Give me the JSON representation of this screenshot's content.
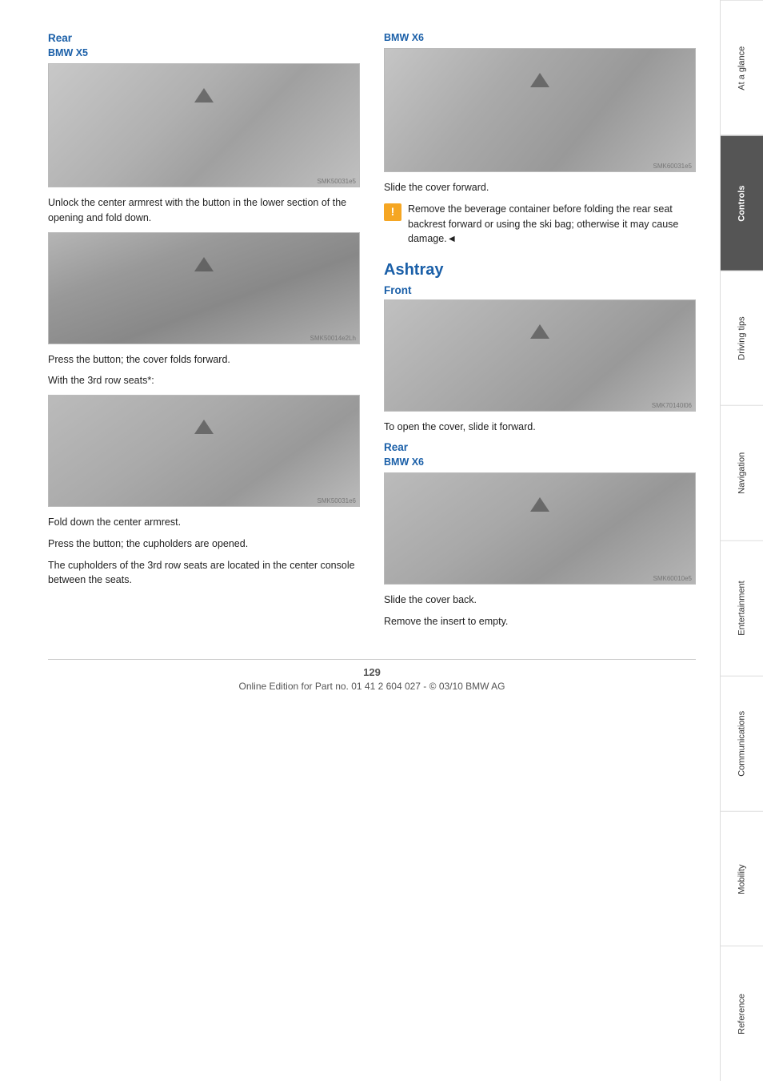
{
  "page": {
    "number": "129",
    "footer_text": "Online Edition for Part no. 01 41 2 604 027 - © 03/10 BMW AG"
  },
  "sidebar": {
    "tabs": [
      {
        "id": "at-a-glance",
        "label": "At a glance",
        "active": false
      },
      {
        "id": "controls",
        "label": "Controls",
        "active": true
      },
      {
        "id": "driving-tips",
        "label": "Driving tips",
        "active": false
      },
      {
        "id": "navigation",
        "label": "Navigation",
        "active": false
      },
      {
        "id": "entertainment",
        "label": "Entertainment",
        "active": false
      },
      {
        "id": "communications",
        "label": "Communications",
        "active": false
      },
      {
        "id": "mobility",
        "label": "Mobility",
        "active": false
      },
      {
        "id": "reference",
        "label": "Reference",
        "active": false
      }
    ]
  },
  "left_col": {
    "section_heading": "Rear",
    "sub_heading": "BMW X5",
    "images": {
      "top_watermark": "SMK50031e5",
      "mid_watermark": "SMK50014e2Lh",
      "bot_watermark": "SMK50031e6"
    },
    "text1": "Unlock the center armrest with the button in the lower section of the opening and fold down.",
    "text2": "Press the button; the cover folds forward.",
    "text3": "With the 3rd row seats*:",
    "text4": "Fold down the center armrest.",
    "text5": "Press the button; the cupholders are opened.",
    "text6": "The cupholders of the 3rd row seats are located in the center console between the seats."
  },
  "right_col": {
    "top_section": {
      "heading": "BMW X6",
      "watermark": "SMK60031e5",
      "text": "Slide the cover forward.",
      "warning_text": "Remove the beverage container before folding the rear seat backrest forward or using the ski bag; otherwise it may cause damage.◄"
    },
    "ashtray": {
      "heading": "Ashtray",
      "front_heading": "Front",
      "front_watermark": "SMK70140l06",
      "front_text": "To open the cover, slide it forward.",
      "rear_heading": "Rear",
      "bmwx6_heading": "BMW X6",
      "rear_watermark": "SMK60010e5",
      "rear_text1": "Slide the cover back.",
      "rear_text2": "Remove the insert to empty."
    }
  }
}
